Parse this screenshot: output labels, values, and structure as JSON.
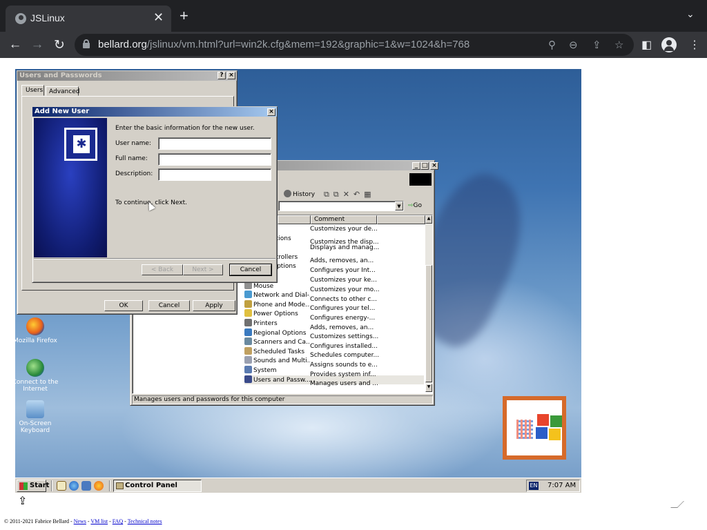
{
  "browser": {
    "tab_title": "JSLinux",
    "url_host": "bellard.org",
    "url_path": "/jslinux/vm.html?url=win2k.cfg&mem=192&graphic=1&w=1024&h=768"
  },
  "desktop": {
    "icons": [
      {
        "label": "Mozilla Firefox",
        "icon": "firefox-icon"
      },
      {
        "label": "Connect to the Internet",
        "icon": "globe-icon"
      },
      {
        "label": "On-Screen Keyboard",
        "icon": "keyboard-icon"
      }
    ]
  },
  "users_dialog": {
    "title": "Users and Passwords",
    "tabs": [
      "Users",
      "Advanced"
    ],
    "ok": "OK",
    "cancel": "Cancel",
    "apply": "Apply"
  },
  "add_user": {
    "title": "Add New User",
    "intro": "Enter the basic information for the new user.",
    "username_label": "User name:",
    "fullname_label": "Full name:",
    "description_label": "Description:",
    "username_value": "",
    "fullname_value": "",
    "description_value": "",
    "continue_text": "To continue, click Next.",
    "back": "< Back",
    "next": "Next >",
    "cancel": "Cancel"
  },
  "control_panel": {
    "history": "History",
    "go": "Go",
    "col_comment": "Comment",
    "status": "Manages users and passwords for this computer",
    "items": [
      {
        "name": "",
        "comment": "Customizes your de..."
      },
      {
        "name": "ptions",
        "comment": "Customizes the disp..."
      },
      {
        "name": "",
        "comment": "Displays and manag..."
      },
      {
        "name": "ntrollers",
        "comment": "Adds, removes, an..."
      },
      {
        "name": "Options",
        "comment": "Configures your Int..."
      },
      {
        "name": "d",
        "comment": "Customizes your ke..."
      },
      {
        "name": "Mouse",
        "comment": "Customizes your mo..."
      },
      {
        "name": "Network and Dial-...",
        "comment": "Connects to other c..."
      },
      {
        "name": "Phone and Mode...",
        "comment": "Configures your tel..."
      },
      {
        "name": "Power Options",
        "comment": "Configures energy-..."
      },
      {
        "name": "Printers",
        "comment": "Adds, removes, an..."
      },
      {
        "name": "Regional Options",
        "comment": "Customizes settings..."
      },
      {
        "name": "Scanners and Ca...",
        "comment": "Configures installed..."
      },
      {
        "name": "Scheduled Tasks",
        "comment": "Schedules computer..."
      },
      {
        "name": "Sounds and Multi...",
        "comment": "Assigns sounds to e..."
      },
      {
        "name": "System",
        "comment": "Provides system inf..."
      },
      {
        "name": "Users and Passw...",
        "comment": "Manages users and ..."
      }
    ]
  },
  "taskbar": {
    "start": "Start",
    "window_button": "Control Panel",
    "lang": "EN",
    "time": "7:07 AM"
  },
  "footer": {
    "copyright": "© 2011-2021 Fabrice Bellard -",
    "links": [
      "News",
      "VM list",
      "FAQ",
      "Technical notes"
    ]
  }
}
